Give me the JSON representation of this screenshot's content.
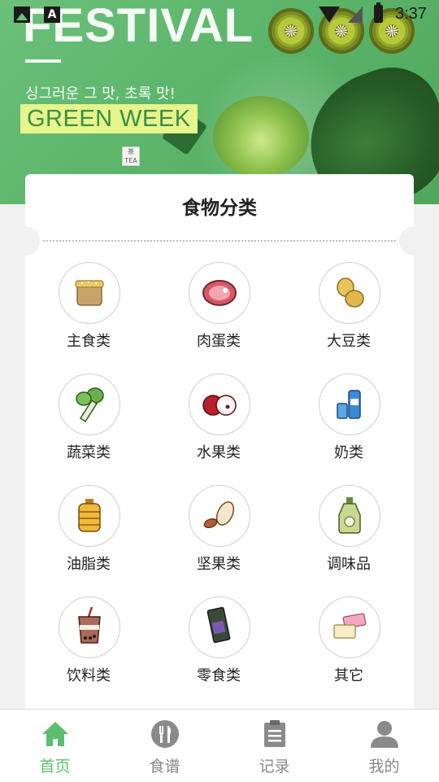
{
  "status_bar": {
    "time": "3:37",
    "app_icon_letter": "A"
  },
  "banner": {
    "headline": "FESTIVAL",
    "korean_text": "싱그러운 그 맛, 초록 맛!",
    "subheadline": "GREEN WEEK",
    "tea_tag_text": "茶 TEA"
  },
  "card": {
    "title": "食物分类",
    "categories": [
      {
        "label": "主食类",
        "icon": "rice-sack-icon"
      },
      {
        "label": "肉蛋类",
        "icon": "meat-icon"
      },
      {
        "label": "大豆类",
        "icon": "soybean-icon"
      },
      {
        "label": "蔬菜类",
        "icon": "bok-choy-icon"
      },
      {
        "label": "水果类",
        "icon": "lychee-icon"
      },
      {
        "label": "奶类",
        "icon": "milk-icon"
      },
      {
        "label": "油脂类",
        "icon": "oil-jar-icon"
      },
      {
        "label": "坚果类",
        "icon": "almond-icon"
      },
      {
        "label": "调味品",
        "icon": "sauce-bottle-icon"
      },
      {
        "label": "饮料类",
        "icon": "bubble-tea-icon"
      },
      {
        "label": "零食类",
        "icon": "seaweed-snack-icon"
      },
      {
        "label": "其它",
        "icon": "other-food-icon"
      }
    ]
  },
  "nav": {
    "items": [
      {
        "label": "首页",
        "icon": "home-icon",
        "active": true
      },
      {
        "label": "食谱",
        "icon": "utensils-icon",
        "active": false
      },
      {
        "label": "记录",
        "icon": "clipboard-icon",
        "active": false
      },
      {
        "label": "我的",
        "icon": "user-icon",
        "active": false
      }
    ]
  },
  "colors": {
    "accent": "#5cbf6e",
    "banner_green": "#5cb56b",
    "inactive": "#888888"
  }
}
